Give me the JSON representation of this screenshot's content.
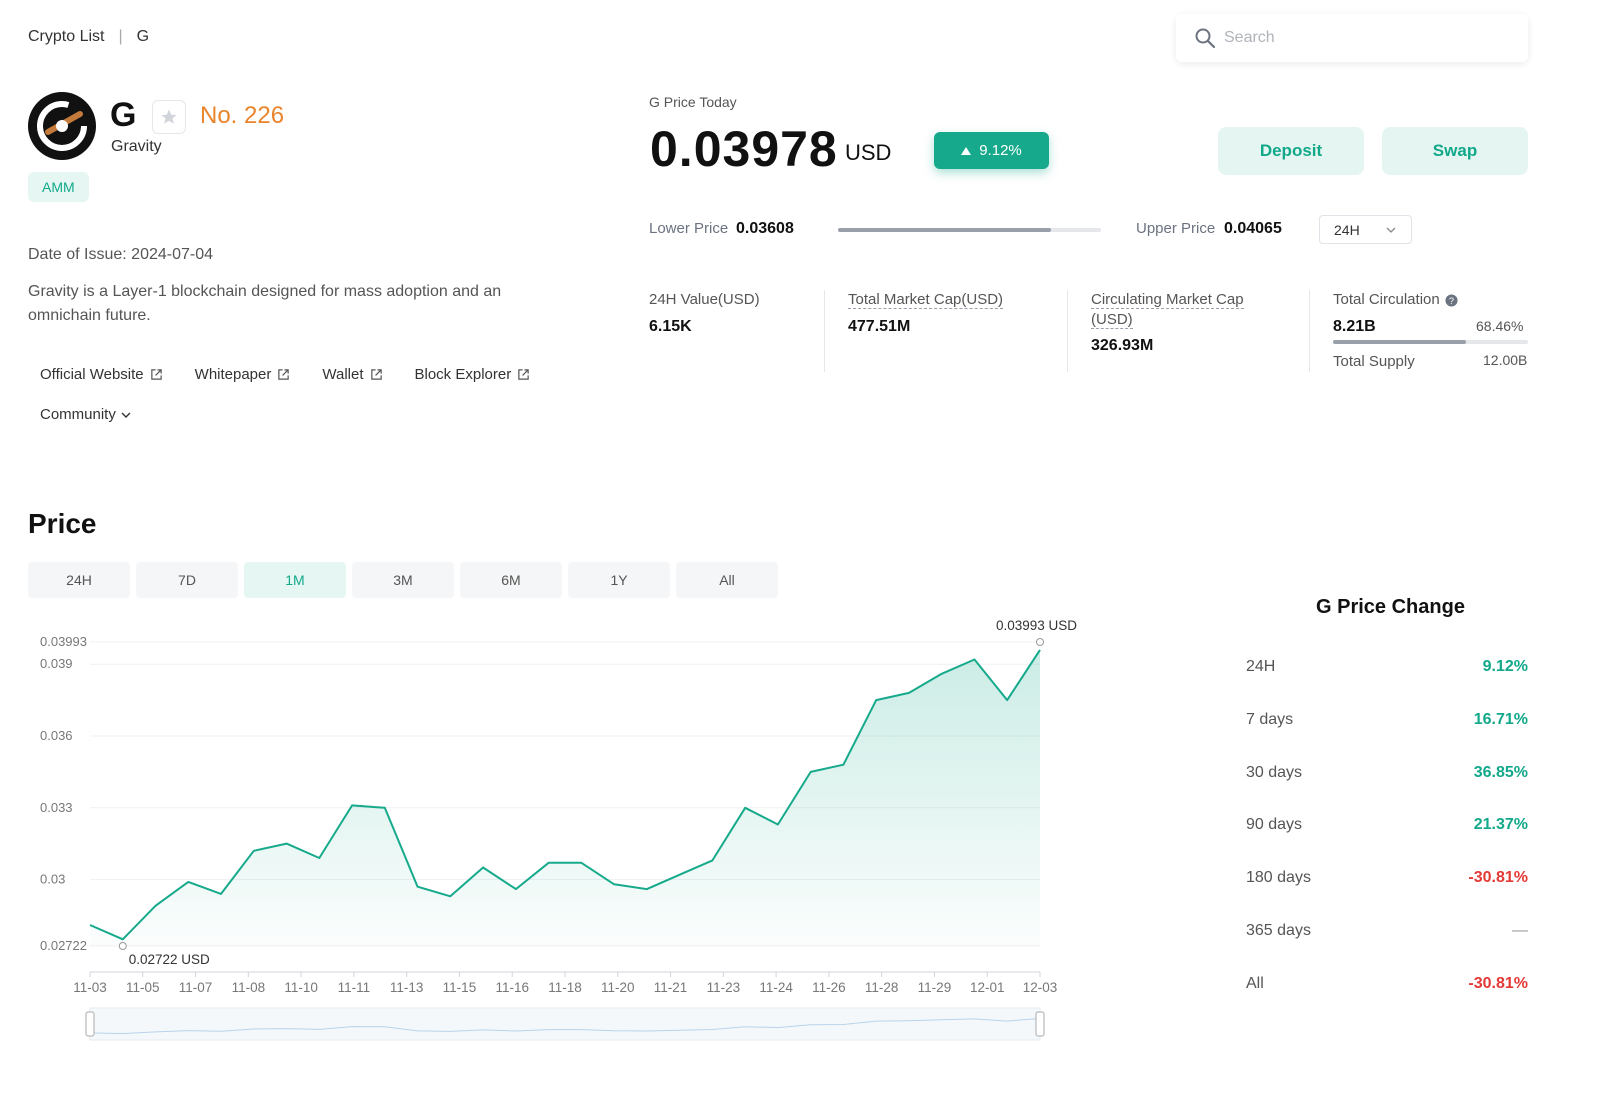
{
  "breadcrumb": {
    "root": "Crypto List",
    "separator": "|",
    "current": "G"
  },
  "search": {
    "placeholder": "Search"
  },
  "token": {
    "symbol": "G",
    "name": "Gravity",
    "rank": "No. 226",
    "tag": "AMM",
    "issue_date": "Date of Issue: 2024-07-04",
    "description": "Gravity is a Layer-1 blockchain designed for mass adoption and an omnichain future."
  },
  "links": {
    "official_website": "Official Website",
    "whitepaper": "Whitepaper",
    "wallet": "Wallet",
    "block_explorer": "Block Explorer",
    "community": "Community"
  },
  "price_today": {
    "label": "G Price Today",
    "price": "0.03978",
    "unit": "USD",
    "change": "9.12%",
    "deposit_label": "Deposit",
    "swap_label": "Swap"
  },
  "range": {
    "lower_label": "Lower Price",
    "lower_value": "0.03608",
    "upper_label": "Upper Price",
    "upper_value": "0.04065",
    "position": 0.81,
    "period": "24H"
  },
  "stats": {
    "value_24h_label": "24H Value(USD)",
    "value_24h": "6.15K",
    "market_cap_label": "Total Market Cap(USD)",
    "market_cap": "477.51M",
    "circ_cap_label_1": "Circulating Market Cap",
    "circ_cap_label_2": "(USD)",
    "circ_cap": "326.93M",
    "circulation_label": "Total Circulation",
    "circulation": "8.21B",
    "circulation_pct": "68.46%",
    "circulation_fraction": 0.6846,
    "supply_label": "Total Supply",
    "supply": "12.00B"
  },
  "price_section": {
    "title": "Price",
    "tabs": [
      "24H",
      "7D",
      "1M",
      "3M",
      "6M",
      "1Y",
      "All"
    ],
    "active_tab": "1M"
  },
  "chart_data": {
    "type": "area",
    "title": "",
    "xlabel": "",
    "ylabel": "",
    "x": [
      "11-03",
      "11-05",
      "11-07",
      "11-08",
      "11-10",
      "11-11",
      "11-13",
      "11-15",
      "11-16",
      "11-18",
      "11-20",
      "11-21",
      "11-23",
      "11-24",
      "11-26",
      "11-28",
      "11-29",
      "12-01",
      "12-03"
    ],
    "y_ticks": [
      "0.03993",
      "0.039",
      "0.036",
      "0.033",
      "0.03",
      "0.02722"
    ],
    "ylim": [
      0.02722,
      0.03993
    ],
    "max_label": "0.03993 USD",
    "min_label": "0.02722 USD",
    "series": [
      {
        "values": [
          0.0281,
          0.0275,
          0.0289,
          0.0299,
          0.0294,
          0.0312,
          0.0315,
          0.0309,
          0.0331,
          0.033,
          0.0297,
          0.0293,
          0.0305,
          0.0296,
          0.0307,
          0.0307,
          0.0298,
          0.0296,
          0.0302,
          0.0308,
          0.033,
          0.0323,
          0.0345,
          0.0348,
          0.0375,
          0.0378,
          0.0386,
          0.0392,
          0.0375,
          0.0396
        ]
      }
    ],
    "color": "#16a98b"
  },
  "price_change": {
    "title": "G Price Change",
    "rows": [
      {
        "label": "24H",
        "value": "9.12%",
        "kind": "pos"
      },
      {
        "label": "7 days",
        "value": "16.71%",
        "kind": "pos"
      },
      {
        "label": "30 days",
        "value": "36.85%",
        "kind": "pos"
      },
      {
        "label": "90 days",
        "value": "21.37%",
        "kind": "pos"
      },
      {
        "label": "180 days",
        "value": "-30.81%",
        "kind": "neg"
      },
      {
        "label": "365 days",
        "value": "—",
        "kind": "na"
      },
      {
        "label": "All",
        "value": "-30.81%",
        "kind": "neg"
      }
    ]
  },
  "colors": {
    "accent": "#16a98b",
    "rank": "#e8852c",
    "negative": "#e53935"
  }
}
